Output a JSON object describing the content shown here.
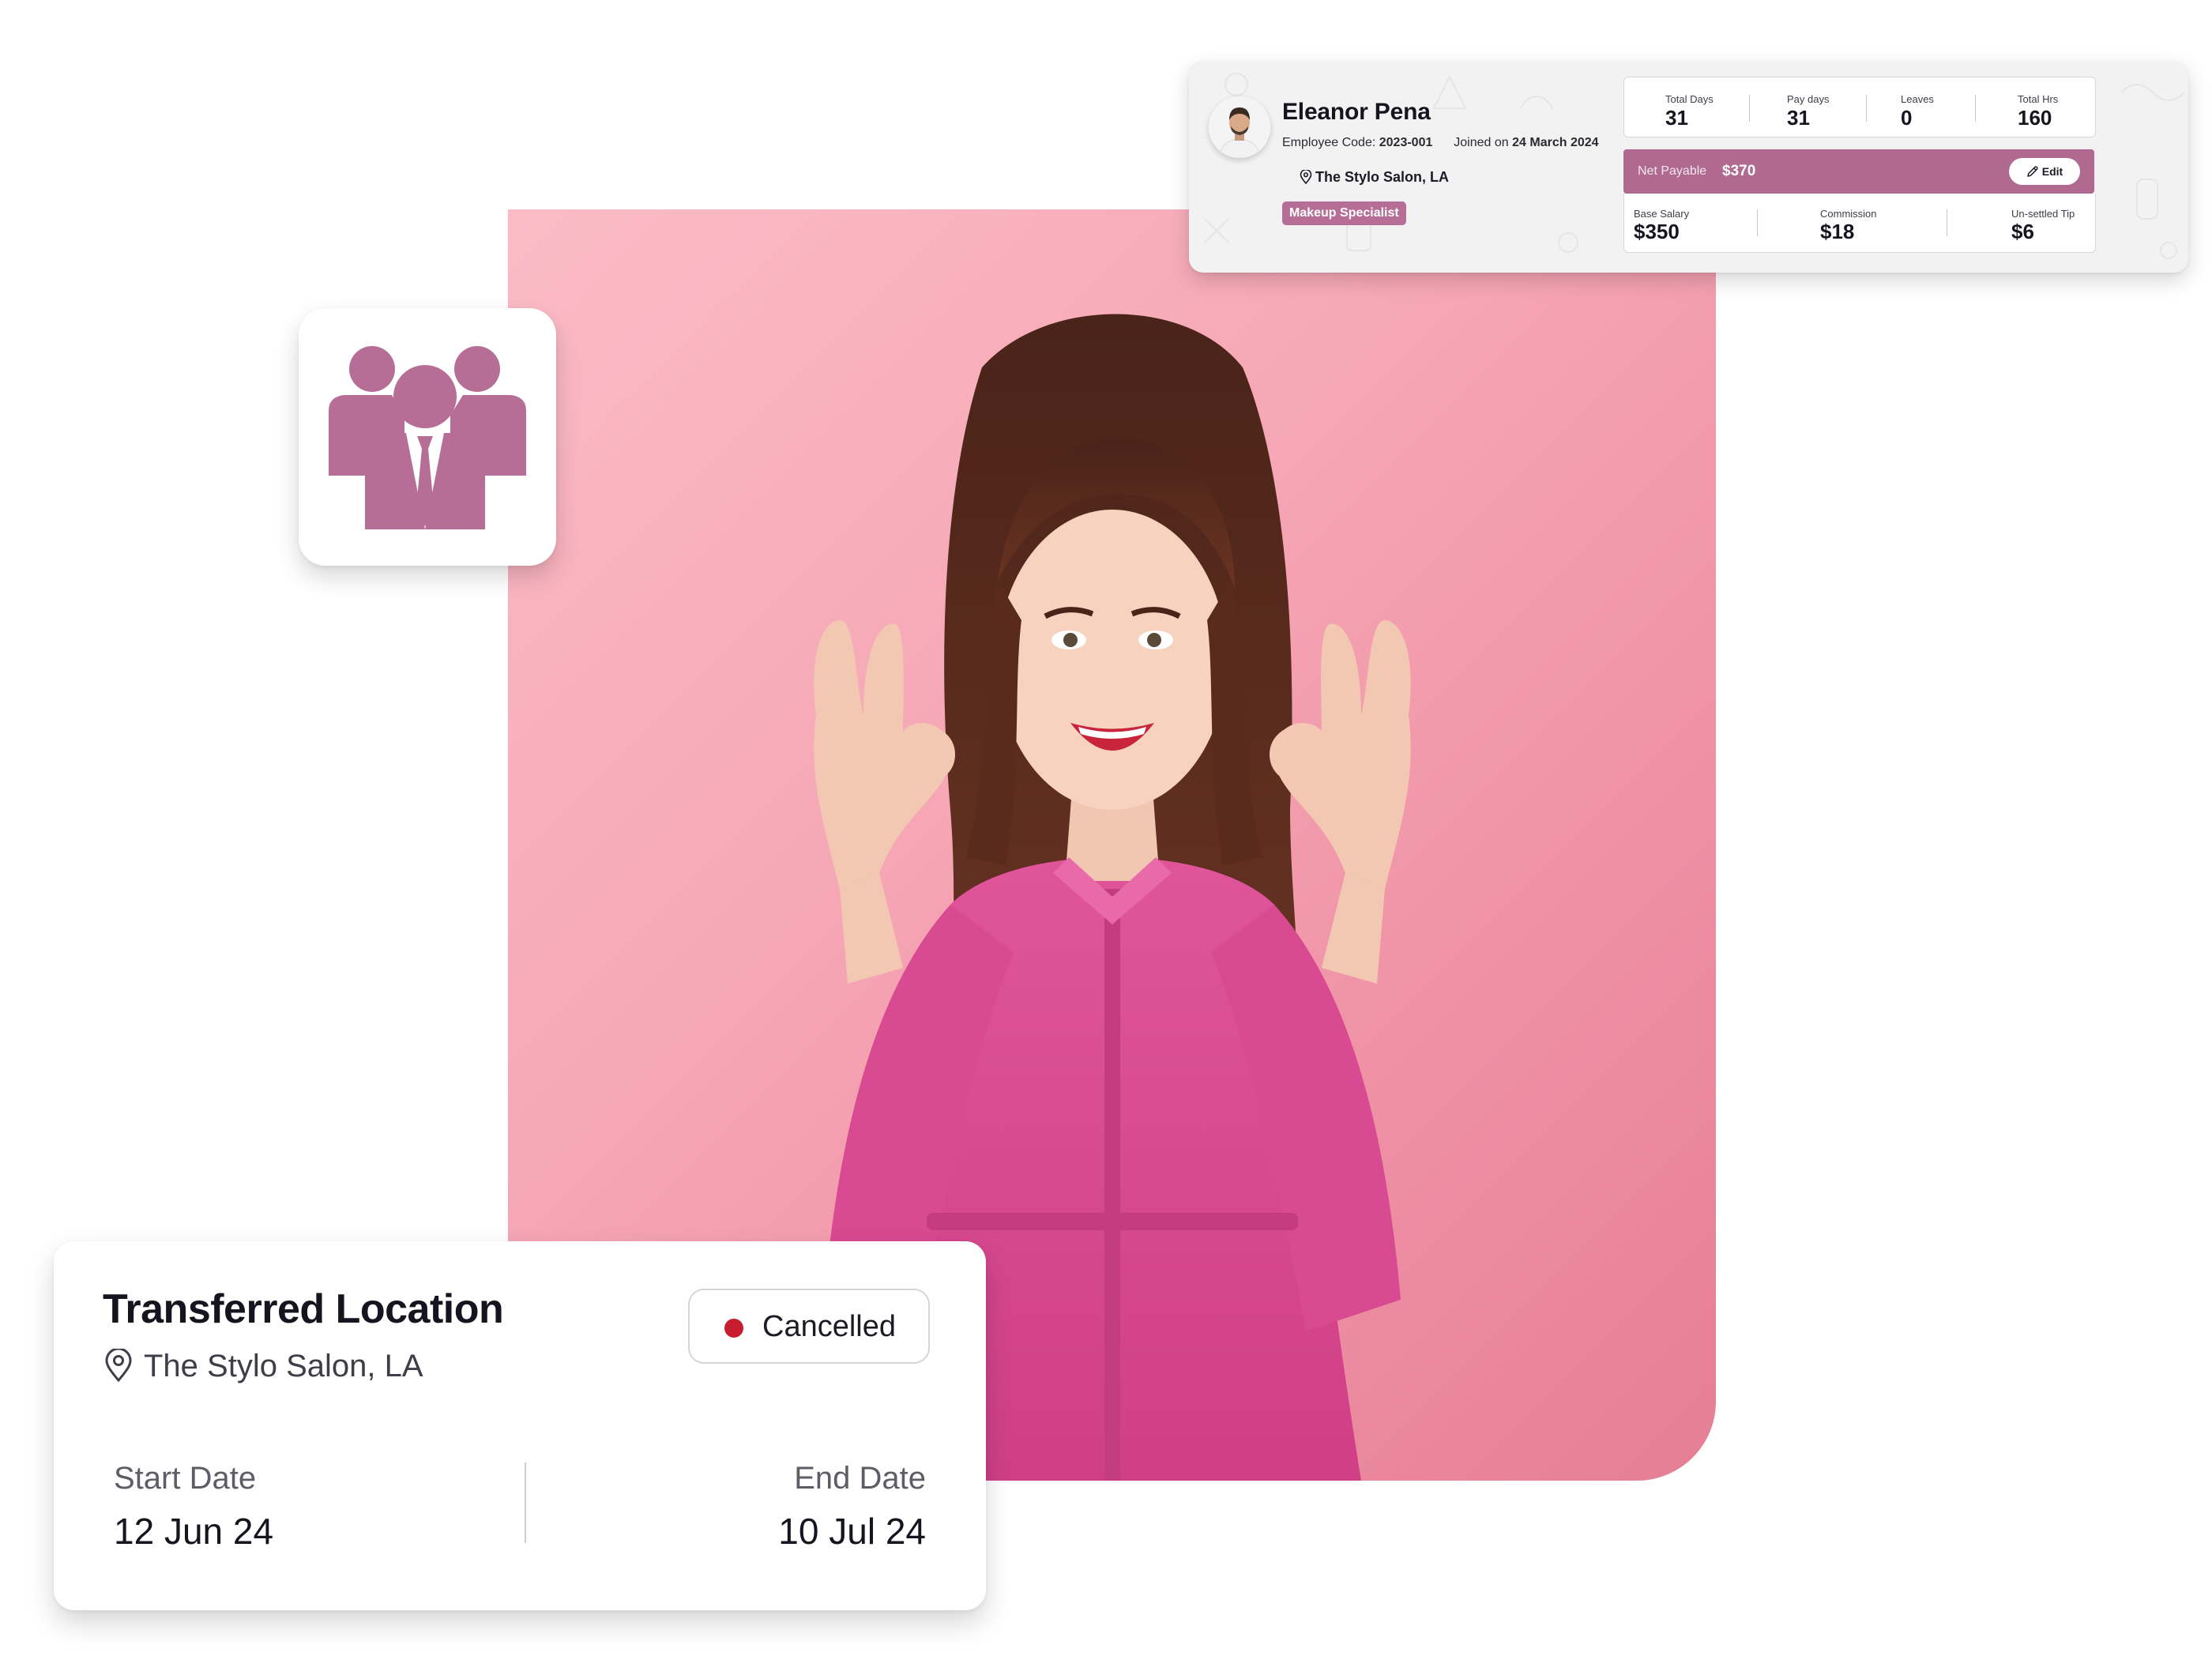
{
  "employee_card": {
    "name": "Eleanor Pena",
    "employee_code_label": "Employee Code:",
    "employee_code": "2023-001",
    "joined_label": "Joined on",
    "joined_date": "24 March 2024",
    "location": "The Stylo Salon, LA",
    "role": "Makeup Specialist",
    "stats": [
      {
        "label": "Total Days",
        "value": "31"
      },
      {
        "label": "Pay days",
        "value": "31"
      },
      {
        "label": "Leaves",
        "value": "0"
      },
      {
        "label": "Total Hrs",
        "value": "160"
      }
    ],
    "net_payable_label": "Net Payable",
    "net_payable_value": "$370",
    "edit_label": "Edit",
    "pay": [
      {
        "label": "Base Salary",
        "value": "$350"
      },
      {
        "label": "Commission",
        "value": "$18"
      },
      {
        "label": "Un-settled Tip",
        "value": "$6"
      }
    ]
  },
  "transfer_card": {
    "title": "Transferred Location",
    "location": "The Stylo Salon, LA",
    "status": "Cancelled",
    "start_label": "Start Date",
    "start_value": "12 Jun 24",
    "end_label": "End Date",
    "end_value": "10 Jul 24"
  },
  "icons": {
    "team": "team-icon",
    "location": "location-pin-icon",
    "edit": "pencil-icon"
  },
  "colors": {
    "brand": "#b66e96",
    "net_bar": "#b06a90",
    "status_cancelled": "#c81d31",
    "hero_bg": "#f6a7b5"
  }
}
